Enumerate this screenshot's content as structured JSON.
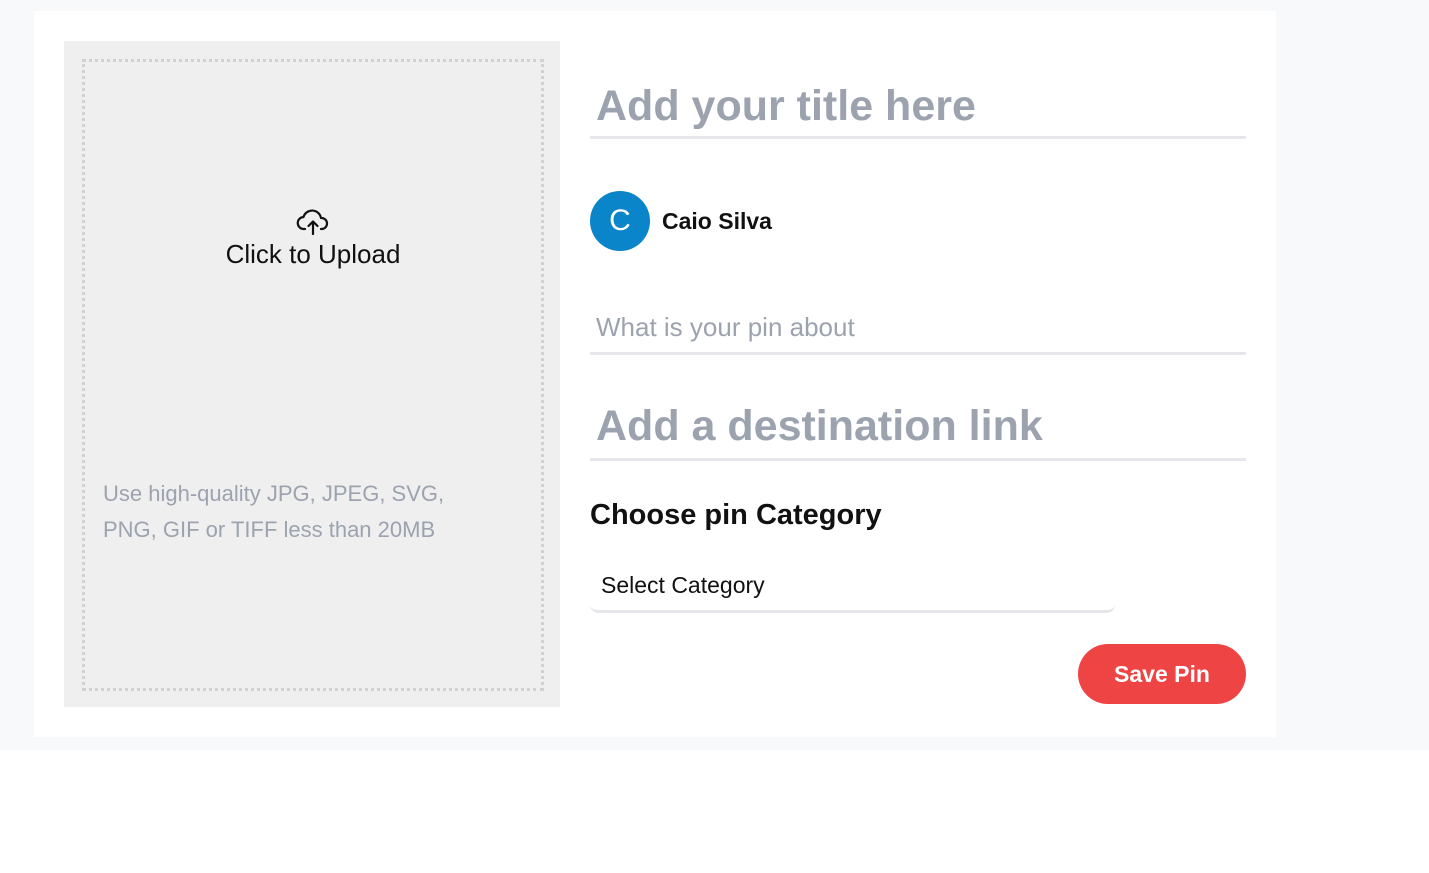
{
  "upload": {
    "icon": "cloud-upload-icon",
    "label": "Click to Upload",
    "hint": "Use high-quality JPG, JPEG, SVG, PNG, GIF or TIFF less than 20MB"
  },
  "form": {
    "title_placeholder": "Add your title here",
    "user": {
      "avatar_initial": "C",
      "name": "Caio Silva",
      "avatar_color": "#0b85c9"
    },
    "about_placeholder": "What is your pin about",
    "link_placeholder": "Add a destination link",
    "category_heading": "Choose pin Category",
    "category_selected": "Select Category",
    "save_label": "Save Pin",
    "save_color": "#ef4444"
  }
}
